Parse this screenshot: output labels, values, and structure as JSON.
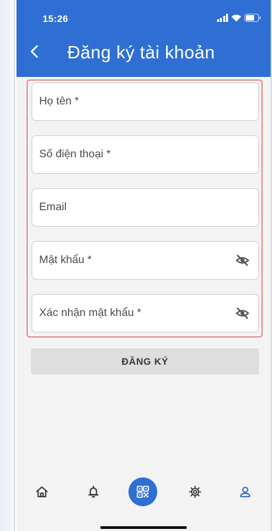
{
  "status_bar": {
    "time": "15:26"
  },
  "header": {
    "title": "Đăng ký tài khoản"
  },
  "form": {
    "fields": [
      {
        "label": "Họ tên *"
      },
      {
        "label": "Số điện thoại *"
      },
      {
        "label": "Email"
      },
      {
        "label": "Mật khẩu *"
      },
      {
        "label": "Xác nhận mật khẩu *"
      }
    ],
    "submit_label": "ĐĂNG KÝ"
  },
  "bottom_nav": {
    "items": [
      "home-icon",
      "bell-icon",
      "qr-code-icon",
      "settings-icon",
      "profile-icon"
    ],
    "active": "profile-icon"
  },
  "colors": {
    "primary": "#2f6fd3",
    "highlight_border": "#e23c46"
  }
}
